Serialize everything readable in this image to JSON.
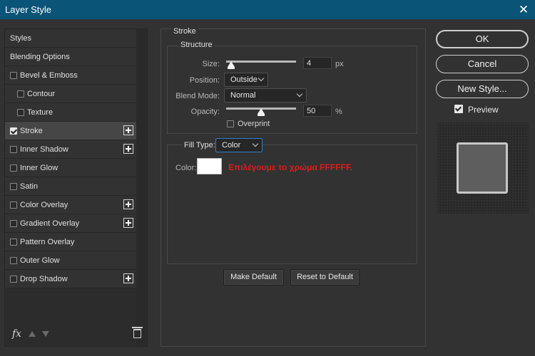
{
  "window": {
    "title": "Layer Style"
  },
  "styles_list": {
    "items": [
      {
        "label": "Styles",
        "checkbox": false,
        "checked": false,
        "plus": false,
        "indent": false
      },
      {
        "label": "Blending Options",
        "checkbox": false,
        "checked": false,
        "plus": false,
        "indent": false
      },
      {
        "label": "Bevel & Emboss",
        "checkbox": true,
        "checked": false,
        "plus": false,
        "indent": false
      },
      {
        "label": "Contour",
        "checkbox": true,
        "checked": false,
        "plus": false,
        "indent": true
      },
      {
        "label": "Texture",
        "checkbox": true,
        "checked": false,
        "plus": false,
        "indent": true
      },
      {
        "label": "Stroke",
        "checkbox": true,
        "checked": true,
        "plus": true,
        "indent": false,
        "active": true
      },
      {
        "label": "Inner Shadow",
        "checkbox": true,
        "checked": false,
        "plus": true,
        "indent": false
      },
      {
        "label": "Inner Glow",
        "checkbox": true,
        "checked": false,
        "plus": false,
        "indent": false
      },
      {
        "label": "Satin",
        "checkbox": true,
        "checked": false,
        "plus": false,
        "indent": false
      },
      {
        "label": "Color Overlay",
        "checkbox": true,
        "checked": false,
        "plus": true,
        "indent": false
      },
      {
        "label": "Gradient Overlay",
        "checkbox": true,
        "checked": false,
        "plus": true,
        "indent": false
      },
      {
        "label": "Pattern Overlay",
        "checkbox": true,
        "checked": false,
        "plus": false,
        "indent": false
      },
      {
        "label": "Outer Glow",
        "checkbox": true,
        "checked": false,
        "plus": false,
        "indent": false
      },
      {
        "label": "Drop Shadow",
        "checkbox": true,
        "checked": false,
        "plus": true,
        "indent": false
      }
    ],
    "footer": {
      "fx_label": "fx"
    }
  },
  "stroke": {
    "section_title": "Stroke",
    "structure_title": "Structure",
    "size": {
      "label": "Size:",
      "value": "4",
      "unit": "px",
      "slider_fraction": 0.02
    },
    "position": {
      "label": "Position:",
      "value": "Outside"
    },
    "blend_mode": {
      "label": "Blend Mode:",
      "value": "Normal"
    },
    "opacity": {
      "label": "Opacity:",
      "value": "50",
      "unit": "%",
      "slider_fraction": 0.5
    },
    "overprint": {
      "label": "Overprint",
      "checked": false
    },
    "fill_type": {
      "label": "Fill Type:",
      "value": "Color"
    },
    "color": {
      "label": "Color:",
      "swatch": "#ffffff"
    },
    "annotation": "Επιλέγουμε το χρώμα FFFFFF."
  },
  "buttons": {
    "make_default": "Make Default",
    "reset_default": "Reset to Default",
    "ok": "OK",
    "cancel": "Cancel",
    "new_style": "New Style...",
    "preview": {
      "label": "Preview",
      "checked": true
    }
  },
  "colors": {
    "titlebar": "#0a5478",
    "annotation": "#e11b1b",
    "focus": "#2d7fc9"
  }
}
